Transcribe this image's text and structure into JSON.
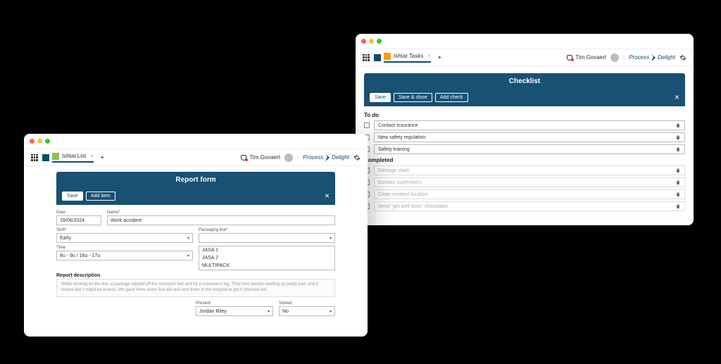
{
  "colors": {
    "panel": "#195173",
    "accent": "#0b4a6f"
  },
  "user": "Tim Govaert",
  "brand": {
    "a": "Process",
    "b": "Delight"
  },
  "left": {
    "tab": "Ishtar.List",
    "panelTitle": "Report form",
    "buttons": {
      "save": "Save",
      "addItem": "Add item"
    },
    "form": {
      "dateLabel": "Date",
      "date": "19/06/2024",
      "nameLabel": "Name*",
      "name": "Work accident",
      "shiftLabel": "Shift*",
      "shift": "Early",
      "lineLabel": "Packaging line*",
      "lineOptions": [
        "JASA 1",
        "JASA 2",
        "MULTIPACK"
      ],
      "timeLabel": "Time",
      "time": "8u - 9u / 16u - 17u",
      "descLabel": "Report description",
      "desc": "While working on the line, a package slipped off the conveyor belt and hit a coworker's leg. Their foot started swelling up pretty bad, and it looked like it might be broken. We gave them some first aid and sent them to the hospital to get it checked out.",
      "presentLabel": "Present",
      "present": "Jordan Riley",
      "solvedLabel": "Solved",
      "solved": "No"
    }
  },
  "right": {
    "tab": "Ishtar.Tasks",
    "panelTitle": "Checklist",
    "buttons": {
      "save": "Save",
      "saveClose": "Save & close",
      "addCheck": "Add check"
    },
    "todoLabel": "To do",
    "todo": [
      "Contact insurance",
      "New safety regulation",
      "Safety training"
    ],
    "completedLabel": "Completed",
    "completed": [
      "Damage claim",
      "Contact supervisors",
      "Clean incident location",
      "Send \"get well soon\" chocolates"
    ]
  }
}
